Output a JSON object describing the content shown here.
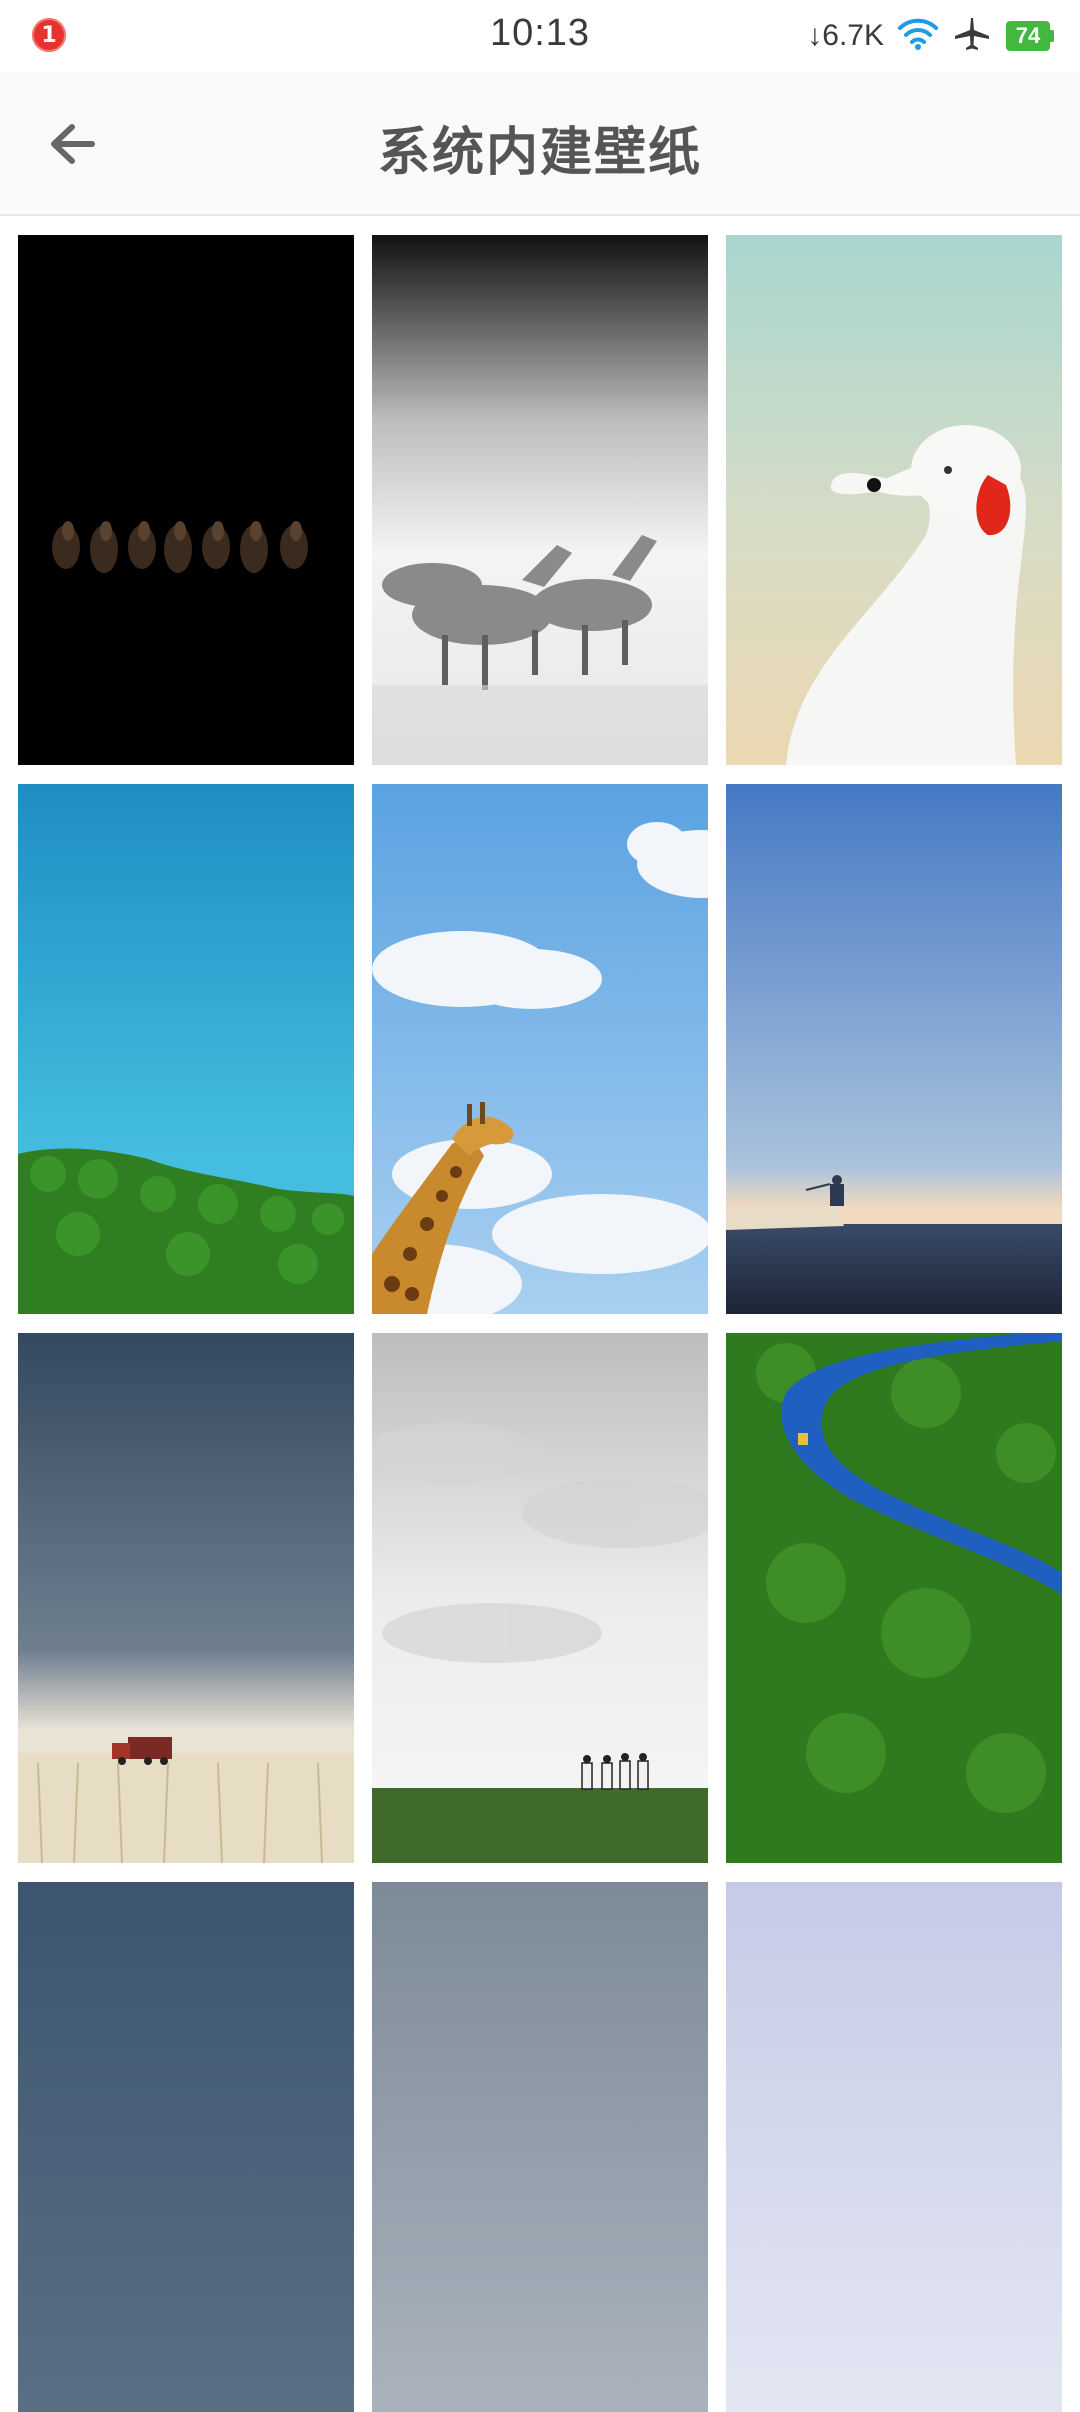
{
  "status_bar": {
    "notification_count": "1",
    "time": "10:13",
    "net_speed": "↓6.7K",
    "battery_level": "74",
    "icons": [
      "download-icon",
      "wifi-icon",
      "airplane-icon",
      "battery-icon"
    ],
    "colors": {
      "badge": "#e8322d",
      "wifi": "#1e9be6",
      "battery": "#43b83e"
    }
  },
  "app_bar": {
    "title": "系统内建壁纸",
    "back_icon": "arrow-left-icon"
  },
  "wallpapers": [
    {
      "name": "horses-on-black"
    },
    {
      "name": "galloping-white-horses"
    },
    {
      "name": "white-dog-red-ear"
    },
    {
      "name": "sky-over-treetops"
    },
    {
      "name": "giraffe-in-sky"
    },
    {
      "name": "man-on-boat"
    },
    {
      "name": "red-truck-in-field"
    },
    {
      "name": "cloudy-sky-figures"
    },
    {
      "name": "river-through-forest"
    },
    {
      "name": "slate-blue-sky"
    },
    {
      "name": "grey-blue-sky"
    },
    {
      "name": "lavender-sky"
    }
  ]
}
